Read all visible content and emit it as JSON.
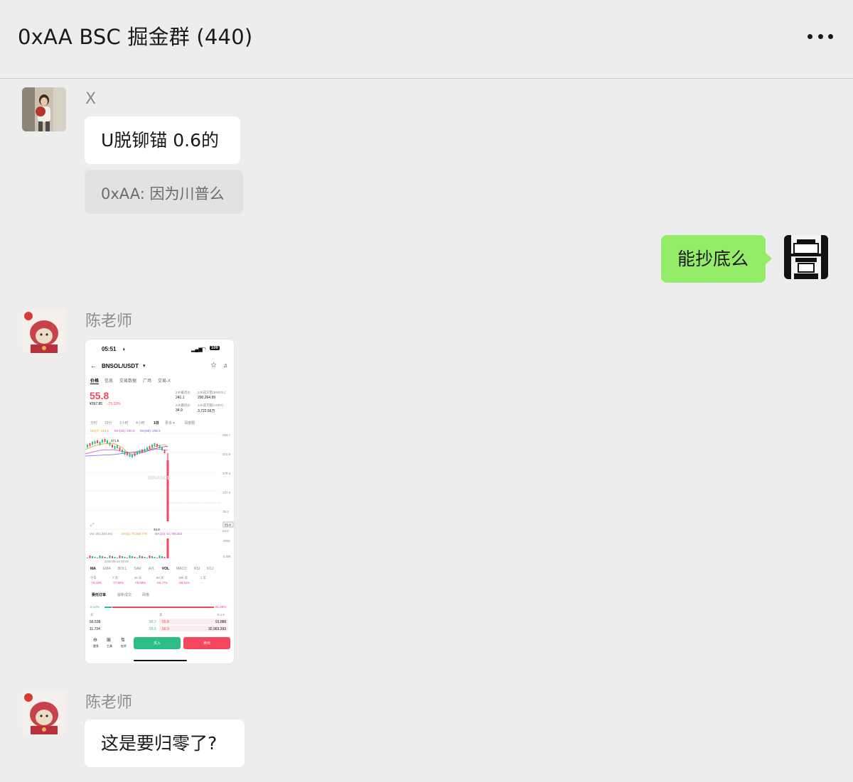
{
  "header": {
    "title": "0xAA BSC 掘金群 (440)"
  },
  "messages": [
    {
      "sender": "X",
      "text": "U脱铆锚 0.6的",
      "quote": "0xAA: 因为川普么"
    },
    {
      "sender": "me",
      "text": "能抄底么"
    },
    {
      "sender": "陈老师",
      "type": "image"
    },
    {
      "sender": "陈老师",
      "text": "这是要归零了?"
    }
  ],
  "phone": {
    "time": "05:51",
    "battery": "100",
    "pair": "BNSOL/USDT",
    "tabs": [
      "价格",
      "信息",
      "交易数据",
      "广场",
      "交易-X"
    ],
    "price": "55.8",
    "price_sub": "¥397.85",
    "change": "-75.33%",
    "stats": [
      {
        "label": "24h最高价",
        "value": "241.1"
      },
      {
        "label": "24h成交量(BNSOL)",
        "value": "290,264.99"
      },
      {
        "label": "24h最低价",
        "value": "34.9"
      },
      {
        "label": "24h成交额(USDT)",
        "value": "3,722.56万"
      }
    ],
    "intervals": [
      "分时",
      "15分",
      "1小时",
      "4小时",
      "1日",
      "更多 ▾",
      "深度图"
    ],
    "ma_line": [
      "MA(7): 213.6",
      "MA(25): 230.9",
      "MA(99): 208.3"
    ],
    "axis": [
      "263.7",
      "221.5",
      "179.4",
      "127.3",
      "75.2",
      "23.0"
    ],
    "high_mark": "271.8",
    "low_mark": "34.9",
    "last_price": "55.8",
    "watermark": "BINANCE",
    "vol_line": [
      "Vol: 281,349.491",
      "MA(5): 70,350.775",
      "MA(10): 51,788.383"
    ],
    "vol_axis": [
      "281K",
      "4.00K"
    ],
    "date": "2025-05-24 00:00",
    "indicators": [
      "MA",
      "EMA",
      "BOLL",
      "SAR",
      "AVL",
      "VOL",
      "MACD",
      "RSI",
      "KDJ"
    ],
    "perf_labels": [
      "今日",
      "7 天",
      "30 天",
      "90 天",
      "180 天",
      "1 年"
    ],
    "perf_values": [
      "-75.33%",
      "-77.90%",
      "-76.68%",
      "-66.77%",
      "-58.51%",
      "--"
    ],
    "book_tabs": [
      "委托订单",
      "最新成交",
      "网格"
    ],
    "book_pct_buy": "8.12%",
    "book_pct_sell": "91.88%",
    "book_head": [
      "买",
      "卖",
      "0.1 ▾"
    ],
    "book_rows": [
      {
        "qty_b": "56.538",
        "bid": "55.7",
        "ask": "55.8",
        "qty_a": "91.886"
      },
      {
        "qty_b": "11.724",
        "bid": "55.6",
        "ask": "56.9",
        "qty_a": "32,963.393"
      }
    ],
    "bottom_icons": [
      "更多",
      "工具",
      "杠杆"
    ],
    "buy": "买入",
    "sell": "卖出"
  },
  "colors": {
    "green_bubble": "#95ec69",
    "up": "#2ebd85",
    "down": "#f6465d"
  }
}
